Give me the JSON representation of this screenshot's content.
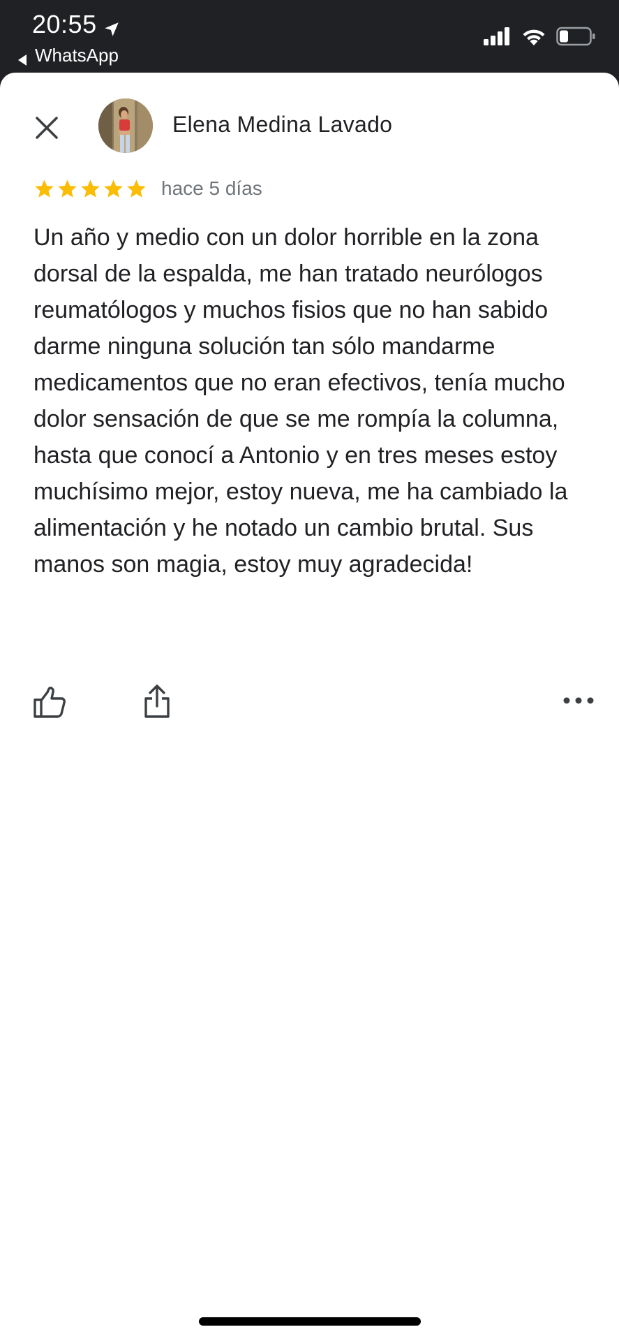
{
  "status_bar": {
    "time": "20:55",
    "back_app_label": "WhatsApp"
  },
  "review": {
    "reviewer_name": "Elena Medina Lavado",
    "rating": 5,
    "rating_max": 5,
    "date": "hace 5 días",
    "text": "Un año y medio con un dolor horrible en la zona dorsal de la espalda, me han tratado neurólogos reumatólogos y muchos fisios que no han sabido darme ninguna solución  tan sólo mandarme medicamentos que no eran efectivos, tenía mucho dolor sensación de que se me rompía la columna, hasta que conocí a Antonio y en tres meses estoy muchísimo mejor, estoy nueva, me ha cambiado la alimentación y he notado un cambio brutal. Sus manos son magia, estoy muy agradecida!"
  },
  "icons": {
    "close": "close-icon",
    "like": "thumbs-up-icon",
    "share": "share-icon",
    "more": "more-horizontal-icon",
    "star": "star-icon",
    "location": "location-arrow-icon",
    "signal": "cellular-signal-icon",
    "wifi": "wifi-icon",
    "battery": "battery-icon"
  },
  "colors": {
    "status_bar_bg": "#202124",
    "sheet_bg": "#ffffff",
    "star": "#fbbc04",
    "text_primary": "#202124",
    "text_secondary": "#70757a",
    "icon": "#3c4043"
  }
}
